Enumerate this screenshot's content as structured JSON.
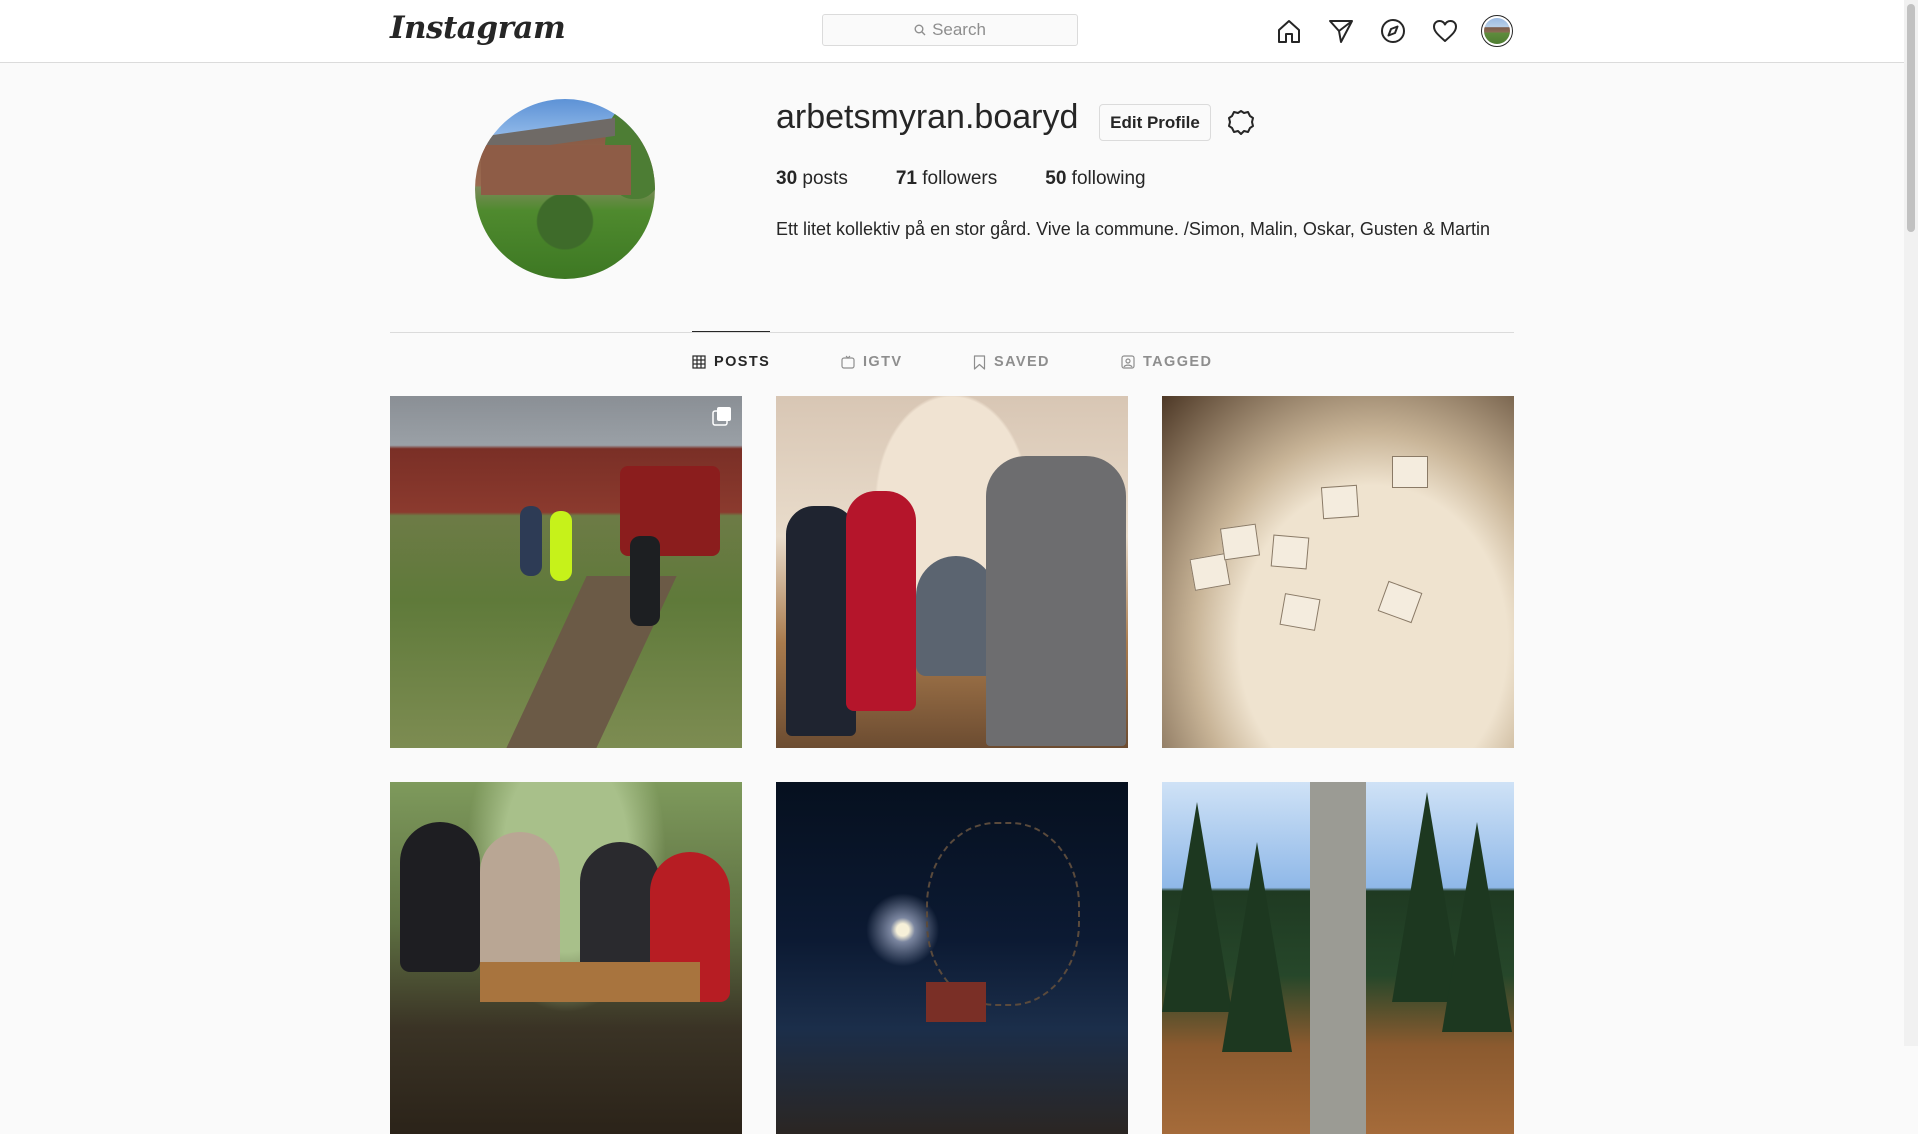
{
  "app": {
    "logo": "Instagram"
  },
  "search": {
    "placeholder": "Search"
  },
  "nav_icons": [
    "home-icon",
    "direct-icon",
    "explore-icon",
    "activity-icon",
    "profile-avatar"
  ],
  "profile": {
    "username": "arbetsmyran.boaryd",
    "edit_label": "Edit Profile",
    "stats": {
      "posts_count": "30",
      "posts_label": "posts",
      "followers_count": "71",
      "followers_label": "followers",
      "following_count": "50",
      "following_label": "following"
    },
    "bio": "Ett litet kollektiv på en stor gård. Vive la commune. /Simon, Malin, Oskar, Gusten & Martin"
  },
  "tabs": [
    {
      "label": "POSTS",
      "icon": "grid-icon",
      "active": true
    },
    {
      "label": "IGTV",
      "icon": "igtv-icon",
      "active": false
    },
    {
      "label": "SAVED",
      "icon": "bookmark-icon",
      "active": false
    },
    {
      "label": "TAGGED",
      "icon": "tagged-icon",
      "active": false
    }
  ],
  "posts": [
    {
      "subject": "farm-work",
      "multi": true
    },
    {
      "subject": "celebration",
      "multi": false
    },
    {
      "subject": "drawings",
      "multi": false
    },
    {
      "subject": "friends-table",
      "multi": false
    },
    {
      "subject": "night-tree",
      "multi": false
    },
    {
      "subject": "forest-road",
      "multi": false
    }
  ],
  "colors": {
    "background": "#fafafa",
    "border": "#dbdbdb",
    "text": "#262626",
    "muted": "#8e8e8e"
  }
}
